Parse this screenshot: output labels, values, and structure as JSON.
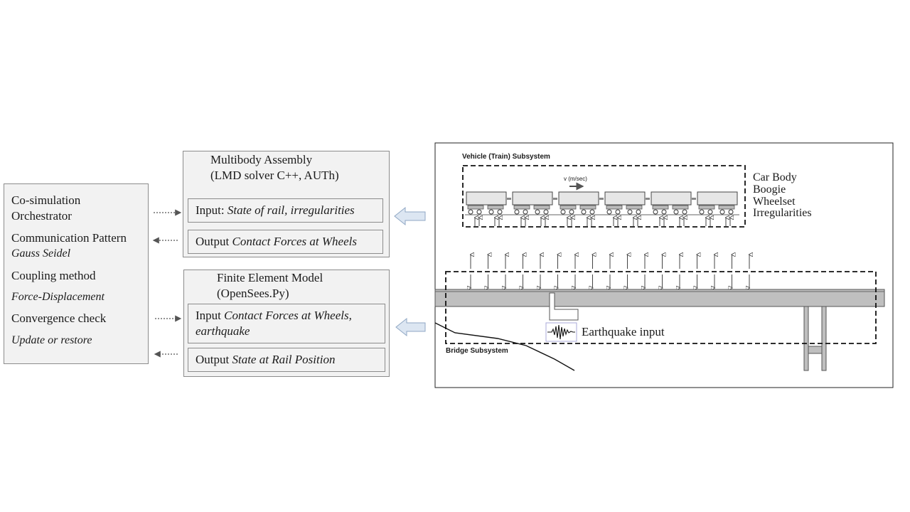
{
  "orchestrator": {
    "title_line1": "Co-simulation",
    "title_line2": "Orchestrator",
    "pattern_label": "Communication Pattern",
    "pattern_value": "Gauss Seidel",
    "coupling_label": "Coupling method",
    "coupling_value": "Force-Displacement",
    "convergence_label": "Convergence check",
    "convergence_value": "Update or restore"
  },
  "multibody": {
    "title": "Multibody Assembly",
    "subtitle": "(LMD solver C++, AUTh)",
    "input_label": "Input:",
    "input_value": "State of rail, irregularities",
    "output_label": "Output",
    "output_value": "Contact Forces at Wheels"
  },
  "fem": {
    "title": "Finite Element Model",
    "subtitle": "(OpenSees.Py)",
    "input_label": "Input",
    "input_value_line1": "Contact Forces at Wheels,",
    "input_value_line2": "earthquake",
    "output_label": "Output",
    "output_value": "State at Rail Position"
  },
  "schematic": {
    "vehicle_label": "Vehicle (Train) Subsystem",
    "speed_label": "v (m/sec)",
    "legend": [
      "Car Body",
      "Boogie",
      "Wheelset",
      "Irregularities"
    ],
    "bridge_label": "Bridge Subsystem",
    "earthquake_label": "Earthquake input"
  }
}
